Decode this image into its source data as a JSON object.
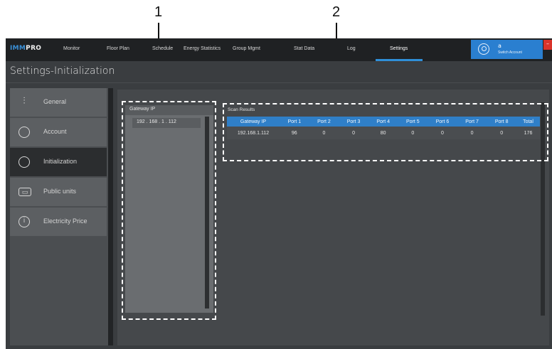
{
  "callouts": [
    "1",
    "2"
  ],
  "topnav": {
    "brand_part1": "IMM",
    "brand_part2": "PRO",
    "items": [
      "Monitor",
      "Floor Plan",
      "Schedule",
      "Energy Statistics",
      "Group Mgmt",
      "Stat Data",
      "Log",
      "Settings"
    ],
    "active_item": "Settings",
    "account": {
      "name": "a",
      "subtitle": "Switch Account"
    },
    "close_symbol": "–"
  },
  "page_title": "Settings-Initialization",
  "sidebar": {
    "items": [
      {
        "label": "General",
        "icon": "sliders-icon",
        "glyph": "⫶"
      },
      {
        "label": "Account",
        "icon": "user-icon",
        "glyph": ""
      },
      {
        "label": "Initialization",
        "icon": "search-gear-icon",
        "glyph": ""
      },
      {
        "label": "Public units",
        "icon": "display-icon",
        "glyph": "▭"
      },
      {
        "label": "Electricity Price",
        "icon": "info-icon",
        "glyph": "i"
      }
    ],
    "active_item": "Initialization"
  },
  "gateway_panel": {
    "header": "Gateway IP",
    "entries": [
      "192 . 168 .  1   . 112"
    ]
  },
  "scan_results": {
    "title": "Scan Results",
    "columns": [
      "Gateway IP",
      "Port 1",
      "Port 2",
      "Port 3",
      "Port 4",
      "Port 5",
      "Port 6",
      "Port 7",
      "Port 8",
      "Total"
    ],
    "rows": [
      [
        "192.168.1.112",
        "96",
        "0",
        "0",
        "80",
        "0",
        "0",
        "0",
        "0",
        "176"
      ]
    ]
  },
  "colors": {
    "accent": "#2f8fd8",
    "nav_bg": "#1f2123",
    "account_bg": "#2a7fd0",
    "close_bg": "#d9342b"
  }
}
